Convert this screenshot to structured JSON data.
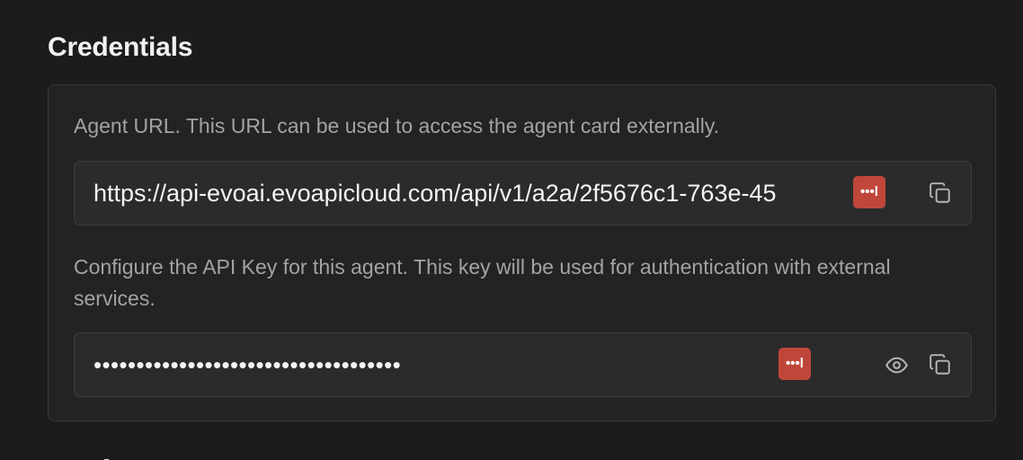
{
  "credentials": {
    "title": "Credentials",
    "agent_url": {
      "description": "Agent URL. This URL can be used to access the agent card externally.",
      "value": "https://api-evoai.evoapicloud.com/api/v1/a2a/2f5676c1-763e-45",
      "password_manager_badge": "•••l",
      "copy_icon": "copy-icon"
    },
    "api_key": {
      "description": "Configure the API Key for this agent. This key will be used for authentication with external services.",
      "masked_value": "••••••••••••••••••••••••••••••••••••",
      "password_manager_badge": "•••l",
      "show_icon": "eye-icon",
      "copy_icon": "copy-icon"
    }
  },
  "colors": {
    "background": "#1c1c1c",
    "card": "#232323",
    "field": "#2b2b2b",
    "border": "#3a3a3a",
    "muted_text": "#a3a3a3",
    "badge": "#c0463b"
  }
}
